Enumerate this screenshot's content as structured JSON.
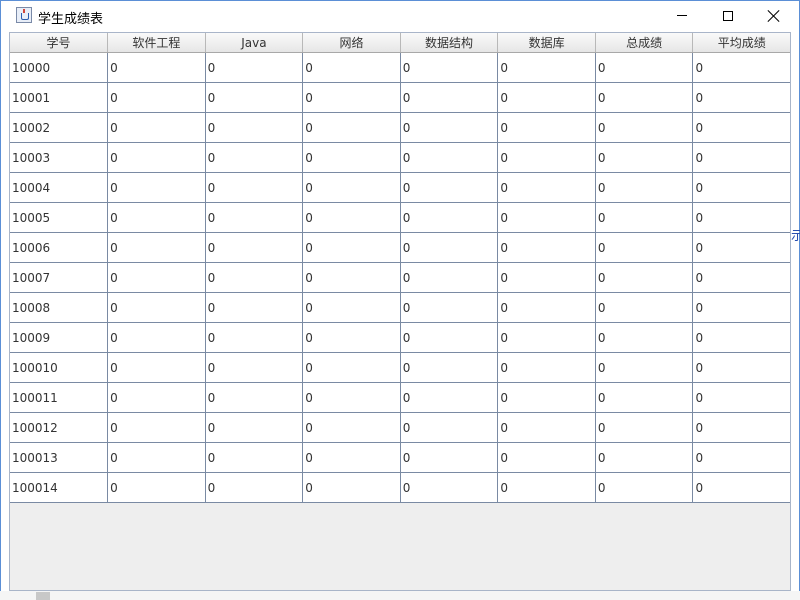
{
  "window": {
    "title": "学生成绩表",
    "icon": "java-cup-icon",
    "accent_color": "#5b8fd6"
  },
  "table": {
    "columns": [
      "学号",
      "软件工程",
      "Java",
      "网络",
      "数据结构",
      "数据库",
      "总成绩",
      "平均成绩"
    ],
    "rows": [
      [
        "10000",
        "0",
        "0",
        "0",
        "0",
        "0",
        "0",
        "0"
      ],
      [
        "10001",
        "0",
        "0",
        "0",
        "0",
        "0",
        "0",
        "0"
      ],
      [
        "10002",
        "0",
        "0",
        "0",
        "0",
        "0",
        "0",
        "0"
      ],
      [
        "10003",
        "0",
        "0",
        "0",
        "0",
        "0",
        "0",
        "0"
      ],
      [
        "10004",
        "0",
        "0",
        "0",
        "0",
        "0",
        "0",
        "0"
      ],
      [
        "10005",
        "0",
        "0",
        "0",
        "0",
        "0",
        "0",
        "0"
      ],
      [
        "10006",
        "0",
        "0",
        "0",
        "0",
        "0",
        "0",
        "0"
      ],
      [
        "10007",
        "0",
        "0",
        "0",
        "0",
        "0",
        "0",
        "0"
      ],
      [
        "10008",
        "0",
        "0",
        "0",
        "0",
        "0",
        "0",
        "0"
      ],
      [
        "10009",
        "0",
        "0",
        "0",
        "0",
        "0",
        "0",
        "0"
      ],
      [
        "100010",
        "0",
        "0",
        "0",
        "0",
        "0",
        "0",
        "0"
      ],
      [
        "100011",
        "0",
        "0",
        "0",
        "0",
        "0",
        "0",
        "0"
      ],
      [
        "100012",
        "0",
        "0",
        "0",
        "0",
        "0",
        "0",
        "0"
      ],
      [
        "100013",
        "0",
        "0",
        "0",
        "0",
        "0",
        "0",
        "0"
      ],
      [
        "100014",
        "0",
        "0",
        "0",
        "0",
        "0",
        "0",
        "0"
      ]
    ]
  },
  "background": {
    "right_edge_text": "示"
  }
}
